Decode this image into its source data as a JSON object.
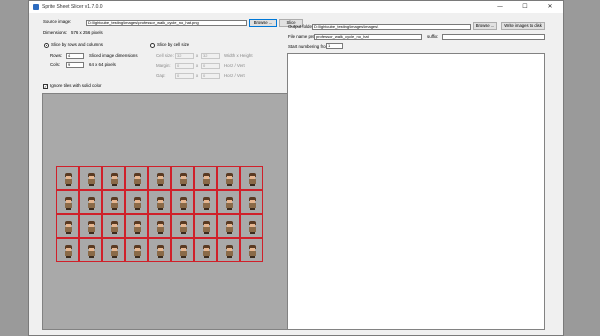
{
  "window": {
    "title": "Sprite Sheet Slicer v1.7.0.0",
    "minimize": "—",
    "maximize": "☐",
    "close": "✕"
  },
  "source": {
    "label": "Source image:",
    "path": "D:\\lightcube_testing\\images\\professor_walk_cycle_no_hat.png",
    "browse": "Browse ...",
    "slice": "Slice",
    "dimensions_label": "Dimensions:",
    "dimensions_value": "576 x 256 pixels"
  },
  "slice_rows_cols": {
    "label": "Slice by rows and columns",
    "rows_label": "Rows:",
    "rows_value": "4",
    "cols_label": "Cols:",
    "cols_value": "9",
    "sliced_label": "Sliced image dimensions",
    "sliced_value": "64 x 64 pixels"
  },
  "slice_cell": {
    "label": "Slice by cell size",
    "cell_label": "Cell size:",
    "cell_w": "32",
    "cell_h": "32",
    "cell_unit": "Width x Height",
    "margin_label": "Margin:",
    "margin_h": "0",
    "margin_v": "0",
    "margin_unit": "Horz / Vert",
    "gap_label": "Gap:",
    "gap_h": "0",
    "gap_v": "0",
    "gap_unit": "Horz / Vert",
    "x": "x"
  },
  "ignore_tiles": {
    "label": "Ignore tiles with solid color",
    "checked": true
  },
  "sheet": {
    "rows": 4,
    "cols": 9
  },
  "output": {
    "folder_label": "Output folder:",
    "folder_value": "D:\\lightcube_testing\\images\\images\\",
    "browse": "Browse ...",
    "write": "Write images to disk",
    "prefix_label": "File name prefix:",
    "prefix_value": "professor_walk_cycle_no_hat",
    "suffix_label": "suffix:",
    "suffix_value": "",
    "start_label": "Start numbering from:",
    "start_value": "1"
  }
}
